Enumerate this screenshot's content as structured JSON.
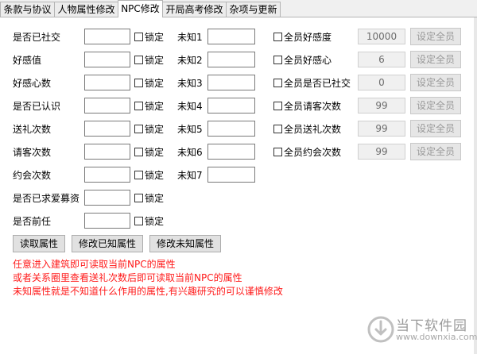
{
  "tabs": [
    "条款与协议",
    "人物属性修改",
    "NPC修改",
    "开局高考修改",
    "杂项与更新"
  ],
  "fields": [
    {
      "label": "是否已社交",
      "lock": "锁定"
    },
    {
      "label": "好感值",
      "lock": "锁定"
    },
    {
      "label": "好感心数",
      "lock": "锁定"
    },
    {
      "label": "是否已认识",
      "lock": "锁定"
    },
    {
      "label": "送礼次数",
      "lock": "锁定"
    },
    {
      "label": "请客次数",
      "lock": "锁定"
    },
    {
      "label": "约会次数",
      "lock": "锁定"
    },
    {
      "label": "是否已求爱募资",
      "lock": "锁定"
    },
    {
      "label": "是否前任",
      "lock": "锁定"
    }
  ],
  "unknown": [
    "未知1",
    "未知2",
    "未知3",
    "未知4",
    "未知5",
    "未知6",
    "未知7"
  ],
  "all": [
    {
      "label": "全员好感度",
      "value": "10000",
      "button": "设定全员"
    },
    {
      "label": "全员好感心",
      "value": "6",
      "button": "设定全员"
    },
    {
      "label": "全员是否已社交",
      "value": "0",
      "button": "设定全员"
    },
    {
      "label": "全员请客次数",
      "value": "99",
      "button": "设定全员"
    },
    {
      "label": "全员送礼次数",
      "value": "99",
      "button": "设定全员"
    },
    {
      "label": "全员约会次数",
      "value": "99",
      "button": "设定全员"
    }
  ],
  "buttons": {
    "read": "读取属性",
    "modify_known": "修改已知属性",
    "modify_unknown": "修改未知属性"
  },
  "notes": [
    "任意进入建筑即可读取当前NPC的属性",
    "或者关系圈里查看送礼次数后即可读取当前NPC的属性",
    "未知属性就是不知道什么作用的属性,有兴趣研究的可以谨慎修改"
  ],
  "watermark": {
    "name": "当下软件园",
    "url": "www.downxia.com"
  },
  "colors": {
    "note": "#ff1a1a",
    "disabled_text": "#9a9a9a",
    "window_bg": "#f0f0f0"
  }
}
